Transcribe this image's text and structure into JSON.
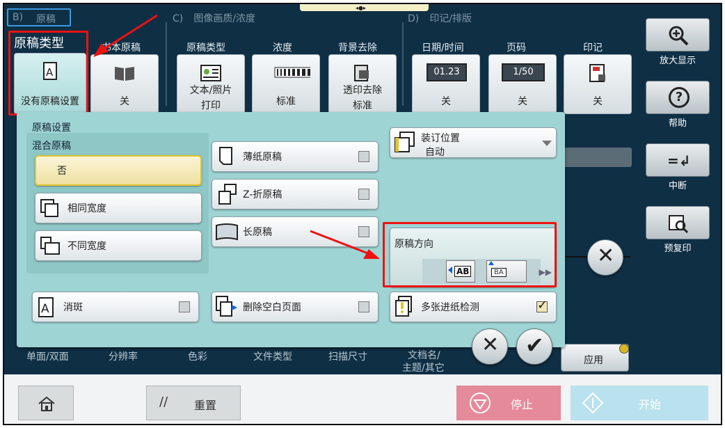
{
  "sections": {
    "b": "B)",
    "b_label": "原稿",
    "c": "C)",
    "c_label": "图像画质/浓度",
    "d": "D)",
    "d_label": "印记/排版"
  },
  "top": {
    "callout": "原稿类型",
    "col_book": "书本原稿",
    "col_type": "原稿类型",
    "col_density": "浓度",
    "col_bg": "背景去除",
    "col_date": "日期/时间",
    "col_page": "页码",
    "col_stamp": "印记",
    "tile1": "没有原稿设置",
    "tile2": "关",
    "tile3a": "文本/照片",
    "tile3b": "打印",
    "tile4": "标准",
    "tile5a": "透印去除",
    "tile5b": "标准",
    "tile6": "关",
    "tile7": "关",
    "tile8": "关",
    "date_badge": "01.23",
    "page_badge": "1/50"
  },
  "panel": {
    "title": "原稿设置",
    "mixed": "混合原稿",
    "opt_no": "否",
    "opt_same": "相同宽度",
    "opt_diff": "不同宽度",
    "thin": "薄纸原稿",
    "zfold": "Z-折原稿",
    "long": "长原稿",
    "binding": "装订位置",
    "binding_val": "自动",
    "orient": "原稿方向",
    "orient_ab": "AB",
    "orient_ba": "BA",
    "despeckle": "消斑",
    "delete_blank": "删除空白页面",
    "multi_feed": "多张进纸检测"
  },
  "right": {
    "zoom": "放大显示",
    "help": "帮助",
    "interrupt": "中断",
    "preview": "预复印"
  },
  "lower_tabs": {
    "duplex": "单面/双面",
    "resolution": "分辨率",
    "color": "色彩",
    "filetype": "文件类型",
    "scansize": "扫描尺寸",
    "docname1": "文档名/",
    "docname2": "主题/其它",
    "apply": "应用"
  },
  "bottom": {
    "reset": "重置",
    "stop": "停止",
    "start": "开始"
  },
  "colors": {
    "accent_red": "#e11111",
    "panel": "#9fd4d4",
    "stop_pink": "#e58a9a",
    "start_blue": "#b9e1ee"
  }
}
